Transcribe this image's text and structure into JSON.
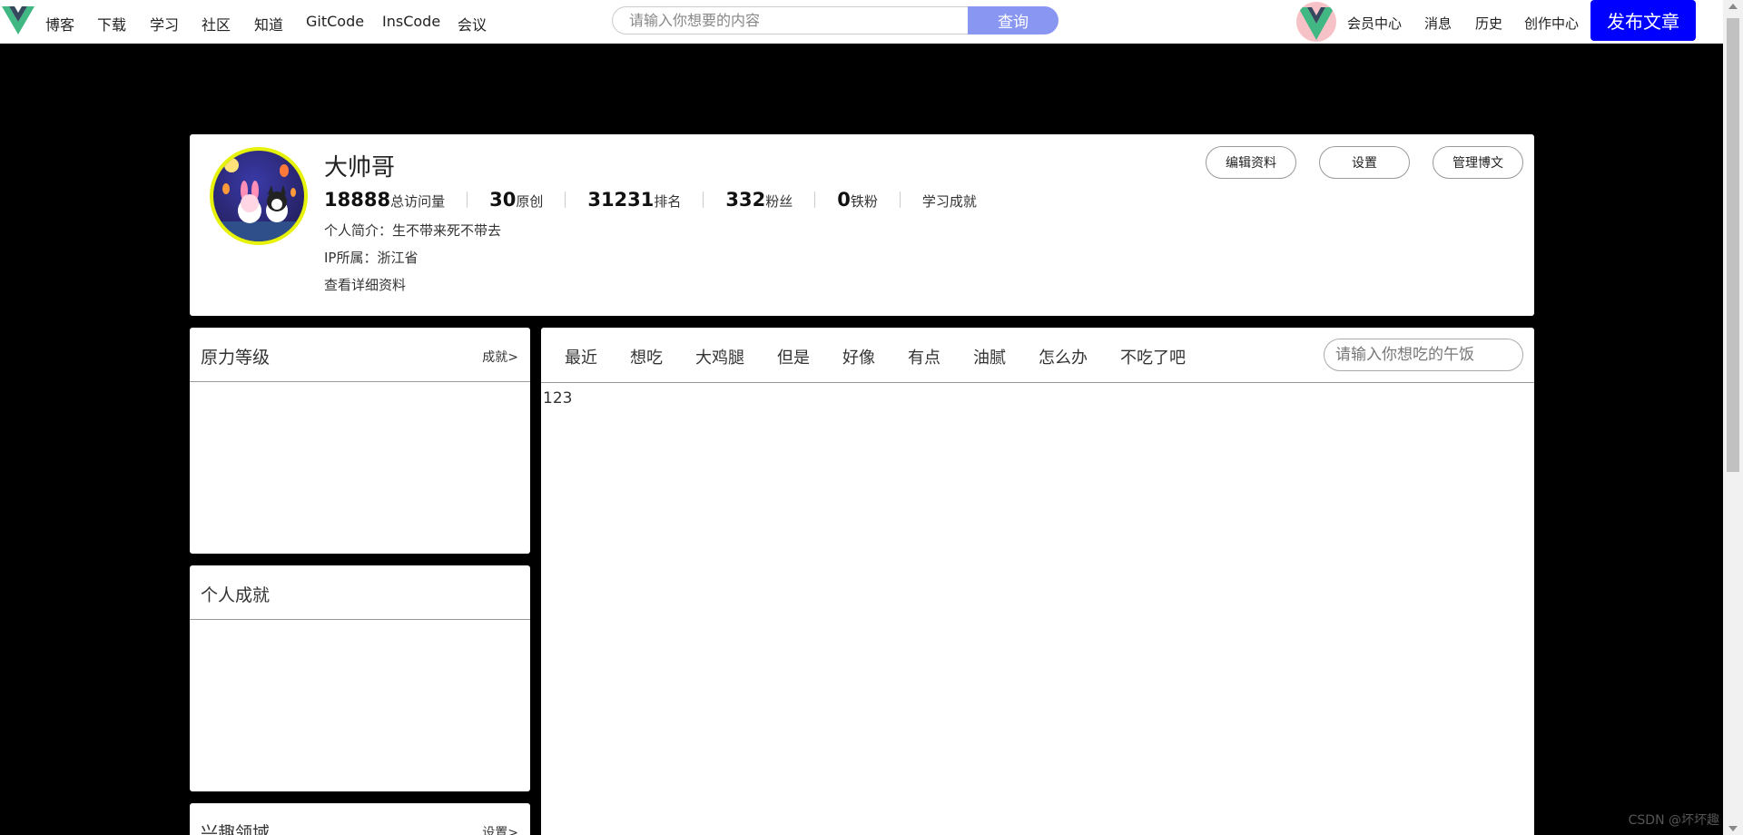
{
  "nav": {
    "logo_icon": "vue-logo-icon",
    "items": [
      "博客",
      "下载",
      "学习",
      "社区",
      "知道",
      "GitCode",
      "InsCode",
      "会议"
    ]
  },
  "search": {
    "placeholder": "请输入你想要的内容",
    "button_label": "查询"
  },
  "user_menu": {
    "member_center": "会员中心",
    "messages": "消息",
    "history": "历史",
    "creator_center": "创作中心",
    "publish_label": "发布文章"
  },
  "profile": {
    "name": "大帅哥",
    "stats": [
      {
        "value": "18888",
        "label": "总访问量"
      },
      {
        "value": "30",
        "label": "原创"
      },
      {
        "value": "31231",
        "label": "排名"
      },
      {
        "value": "332",
        "label": "粉丝"
      },
      {
        "value": "0",
        "label": "铁粉"
      }
    ],
    "achievement_link": "学习成就",
    "bio": "个人简介：生不带来死不带去",
    "ip": "IP所属：浙江省",
    "details_link": "查看详细资料",
    "buttons": {
      "edit": "编辑资料",
      "settings": "设置",
      "manage": "管理博文"
    }
  },
  "sidebar": {
    "level": {
      "title": "原力等级",
      "link": "成就>"
    },
    "achievements": {
      "title": "个人成就"
    },
    "interests": {
      "title": "兴趣领域",
      "link": "设置>"
    }
  },
  "content": {
    "tabs": [
      "最近",
      "想吃",
      "大鸡腿",
      "但是",
      "好像",
      "有点",
      "油腻",
      "怎么办",
      "不吃了吧"
    ],
    "search_placeholder": "请输入你想吃的午饭",
    "body_text": "123"
  },
  "watermark": "CSDN @坏坏趣",
  "colors": {
    "page_background": "#000000",
    "search_button": "#8a97f2",
    "publish_button": "#0000ff",
    "avatar_border": "#e6f20a"
  }
}
